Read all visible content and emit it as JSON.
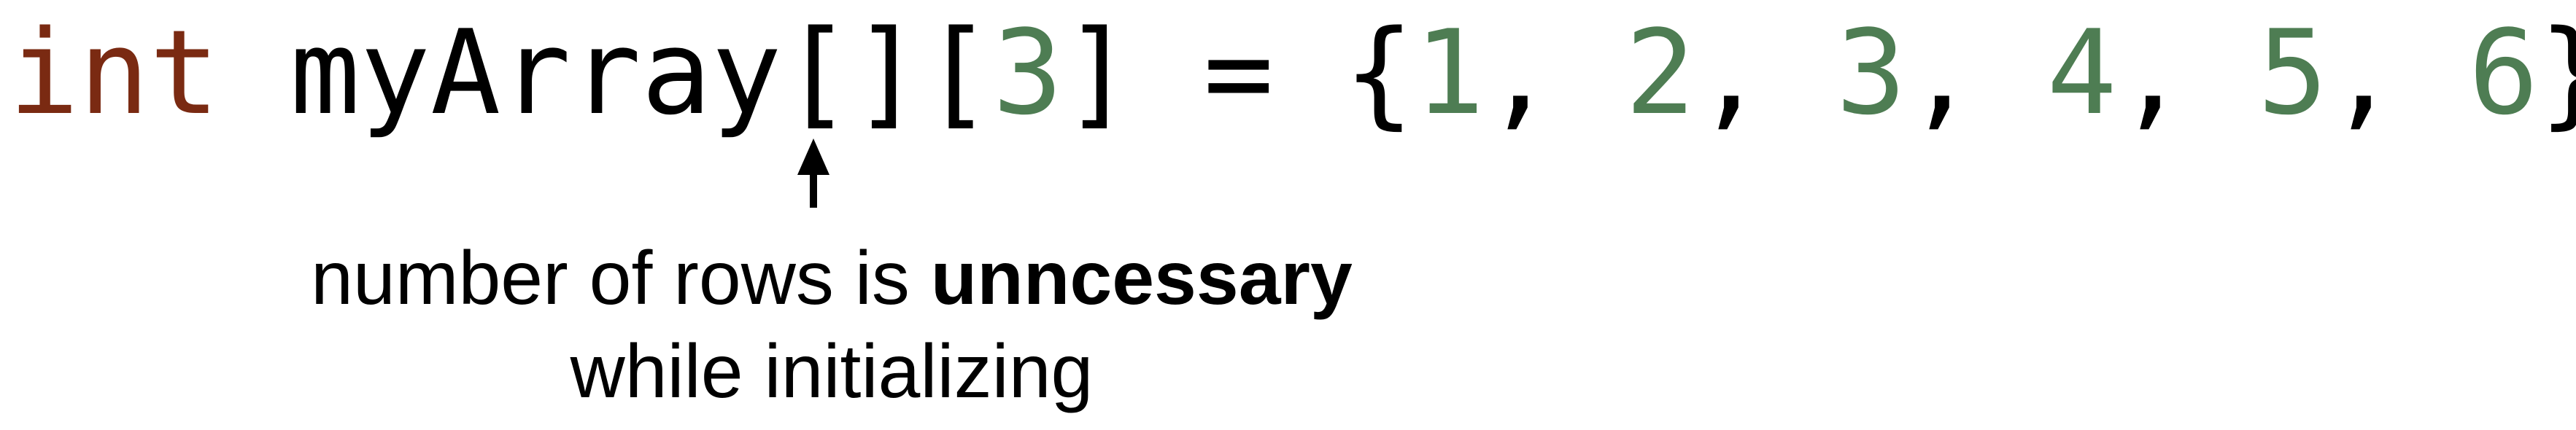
{
  "code": {
    "keyword": "int",
    "space1": " ",
    "identifier": "myArray",
    "empty_brackets": "[]",
    "open_bracket": "[",
    "column_size": "3",
    "close_bracket_assign_open": "] = {",
    "values": [
      "1",
      "2",
      "3",
      "4",
      "5",
      "6"
    ],
    "separator": ", ",
    "closing": "};"
  },
  "annotation": {
    "line1_prefix": "number of rows is ",
    "line1_bold": "unncessary",
    "line2": "while initializing"
  },
  "colors": {
    "keyword": "#7a2a12",
    "number": "#4e7d53",
    "plain": "#000000"
  },
  "icons": {
    "arrow": "up-arrow-icon"
  }
}
